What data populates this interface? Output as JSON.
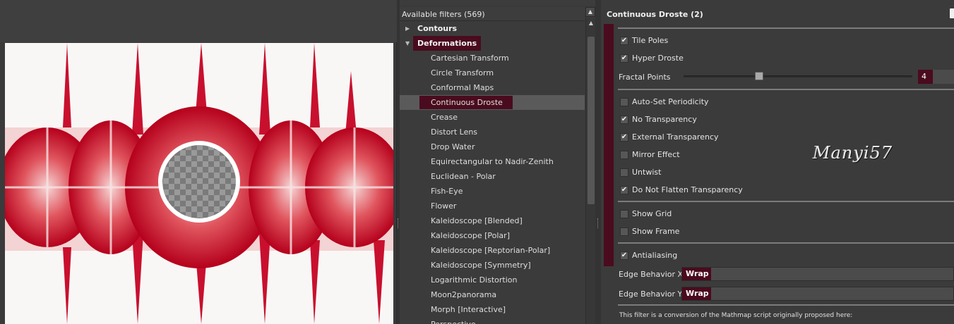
{
  "filters_header": "Available filters (569)",
  "tree": {
    "categories": [
      {
        "label": "Contours",
        "expanded": false
      },
      {
        "label": "Deformations",
        "expanded": true
      }
    ],
    "items": [
      "Cartesian Transform",
      "Circle Transform",
      "Conformal Maps",
      "Continuous Droste",
      "Crease",
      "Distort Lens",
      "Drop Water",
      "Equirectangular to Nadir-Zenith",
      "Euclidean - Polar",
      "Fish-Eye",
      "Flower",
      "Kaleidoscope [Blended]",
      "Kaleidoscope [Polar]",
      "Kaleidoscope [Reptorian-Polar]",
      "Kaleidoscope [Symmetry]",
      "Logarithmic Distortion",
      "Moon2panorama",
      "Morph [Interactive]",
      "Perspective"
    ],
    "selected": "Continuous Droste"
  },
  "params": {
    "title": "Continuous Droste (2)",
    "checks1": [
      {
        "label": "Tile Poles",
        "checked": true
      },
      {
        "label": "Hyper Droste",
        "checked": true
      }
    ],
    "fractal_points": {
      "label": "Fractal Points",
      "value": "4",
      "fraction": 0.33
    },
    "checks2": [
      {
        "label": "Auto-Set Periodicity",
        "checked": false
      },
      {
        "label": "No Transparency",
        "checked": true
      },
      {
        "label": "External Transparency",
        "checked": true
      },
      {
        "label": "Mirror Effect",
        "checked": false
      },
      {
        "label": "Untwist",
        "checked": false
      },
      {
        "label": "Do Not Flatten Transparency",
        "checked": true
      }
    ],
    "checks3": [
      {
        "label": "Show Grid",
        "checked": false
      },
      {
        "label": "Show Frame",
        "checked": false
      }
    ],
    "checks4": [
      {
        "label": "Antialiasing",
        "checked": true
      }
    ],
    "edge_x": {
      "label": "Edge Behavior X",
      "value": "Wrap"
    },
    "edge_y": {
      "label": "Edge Behavior Y",
      "value": "Wrap"
    },
    "description": "This filter is a conversion of the Mathmap script originally proposed here:"
  },
  "watermark": "Manyi57",
  "colors": {
    "accent": "#4a0b1e",
    "preview_red": "#c8102e"
  }
}
